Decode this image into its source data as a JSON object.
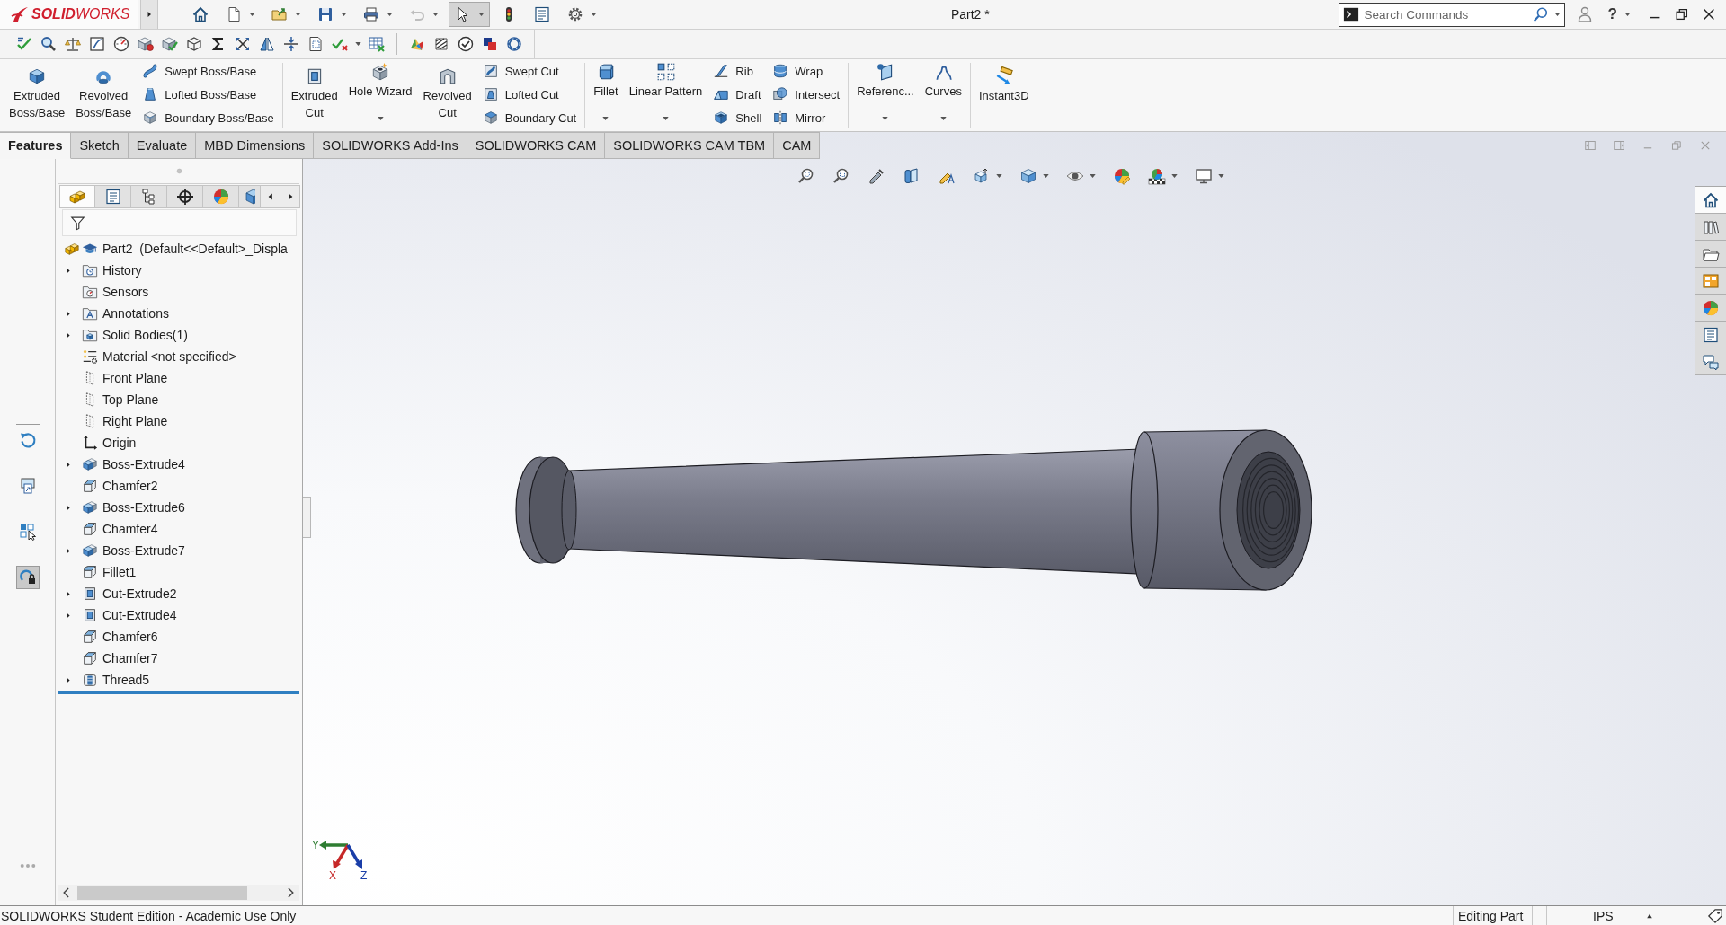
{
  "title_bar": {
    "logo": "**SOLID**WORKS",
    "quick_access": [
      {
        "kind": "home",
        "dropdown": false,
        "pressed": false,
        "disabled": false
      },
      {
        "kind": "new",
        "dropdown": true,
        "pressed": false,
        "disabled": false
      },
      {
        "kind": "open",
        "dropdown": true,
        "pressed": false,
        "disabled": false
      },
      {
        "kind": "save",
        "dropdown": true,
        "pressed": false,
        "disabled": false
      },
      {
        "kind": "print",
        "dropdown": true,
        "pressed": false,
        "disabled": false
      },
      {
        "kind": "undo",
        "dropdown": true,
        "pressed": false,
        "disabled": true
      },
      {
        "kind": "select",
        "dropdown": true,
        "pressed": true,
        "disabled": false
      },
      {
        "kind": "rebuild",
        "dropdown": false,
        "pressed": false,
        "disabled": false
      },
      {
        "kind": "file-properties",
        "dropdown": false,
        "pressed": false,
        "disabled": false
      },
      {
        "kind": "options",
        "dropdown": true,
        "pressed": false,
        "disabled": false
      }
    ],
    "document_title": "Part2 *",
    "search": {
      "placeholder": "Search Commands"
    },
    "help": "?"
  },
  "toolbar": [
    [
      {
        "kind": "tick",
        "dropdown": false
      },
      {
        "kind": "magnifier",
        "dropdown": false
      },
      {
        "kind": "balance",
        "dropdown": false
      },
      {
        "kind": "curve-box",
        "dropdown": false
      },
      {
        "kind": "gauge",
        "dropdown": false
      },
      {
        "kind": "cube-dot",
        "dropdown": false
      },
      {
        "kind": "cube-check",
        "dropdown": false
      },
      {
        "kind": "cube-outline",
        "dropdown": false
      },
      {
        "kind": "sigma",
        "dropdown": false
      },
      {
        "kind": "cross-arrows",
        "dropdown": false
      },
      {
        "kind": "mirror-halves",
        "dropdown": false
      },
      {
        "kind": "compress",
        "dropdown": false
      },
      {
        "kind": "dashed-doc",
        "dropdown": false
      },
      {
        "kind": "tick-cross",
        "dropdown": true
      },
      {
        "kind": "table-cross",
        "dropdown": false
      }
    ],
    [
      {
        "kind": "color-map",
        "dropdown": false
      },
      {
        "kind": "stripes",
        "dropdown": false
      },
      {
        "kind": "check-circle",
        "dropdown": false
      },
      {
        "kind": "squares",
        "dropdown": false
      },
      {
        "kind": "ring",
        "dropdown": false
      }
    ]
  ],
  "command_manager": {
    "groups": [
      {
        "items": [
          {
            "kind": "large",
            "label": "Extruded Boss/Base",
            "dropdown": false
          },
          {
            "kind": "large",
            "label": "Revolved Boss/Base",
            "dropdown": false
          },
          {
            "kind": "stack",
            "rows": [
              "Swept Boss/Base",
              "Lofted Boss/Base",
              "Boundary Boss/Base"
            ]
          }
        ]
      },
      {
        "items": [
          {
            "kind": "large",
            "label": "Extruded Cut",
            "dropdown": false
          },
          {
            "kind": "large",
            "label": "Hole Wizard",
            "dropdown": true
          },
          {
            "kind": "large",
            "label": "Revolved Cut",
            "dropdown": false
          },
          {
            "kind": "stack",
            "rows": [
              "Swept Cut",
              "Lofted Cut",
              "Boundary Cut"
            ]
          }
        ]
      },
      {
        "items": [
          {
            "kind": "large",
            "label": "Fillet",
            "dropdown": true
          },
          {
            "kind": "large",
            "label": "Linear Pattern",
            "dropdown": true
          },
          {
            "kind": "stack",
            "rows": [
              "Rib",
              "Draft",
              "Shell"
            ]
          },
          {
            "kind": "stack",
            "rows": [
              "Wrap",
              "Intersect",
              "Mirror"
            ]
          }
        ]
      },
      {
        "items": [
          {
            "kind": "large",
            "label": "Referenc...",
            "dropdown": true
          },
          {
            "kind": "large",
            "label": "Curves",
            "dropdown": true
          }
        ]
      },
      {
        "items": [
          {
            "kind": "large",
            "label": "Instant3D",
            "dropdown": false
          }
        ]
      }
    ]
  },
  "command_tabs": [
    {
      "label": "Features",
      "selected": true
    },
    {
      "label": "Sketch",
      "selected": false
    },
    {
      "label": "Evaluate",
      "selected": false
    },
    {
      "label": "MBD Dimensions",
      "selected": false
    },
    {
      "label": "SOLIDWORKS Add-Ins",
      "selected": false
    },
    {
      "label": "SOLIDWORKS CAM",
      "selected": false
    },
    {
      "label": "SOLIDWORKS CAM TBM",
      "selected": false
    },
    {
      "label": "CAM",
      "selected": false
    }
  ],
  "left_strip": [
    {
      "kind": "rollback",
      "pressed": false
    },
    {
      "kind": "export",
      "pressed": false
    },
    {
      "kind": "layout",
      "pressed": false
    },
    {
      "kind": "lock",
      "pressed": true
    }
  ],
  "feature_manager": {
    "panel_tabs": [
      {
        "kind": "feature-tree",
        "selected": true
      },
      {
        "kind": "property-list",
        "selected": false
      },
      {
        "kind": "configurations",
        "selected": false
      },
      {
        "kind": "dimxpert",
        "selected": false
      },
      {
        "kind": "display",
        "selected": false
      },
      {
        "kind": "cam",
        "selected": false
      }
    ],
    "tree": {
      "label": "Part2  (Default<<Default>_Displa",
      "kind": "part",
      "children": [
        {
          "label": "History",
          "kind": "history",
          "expandable": true
        },
        {
          "label": "Sensors",
          "kind": "sensors",
          "expandable": false
        },
        {
          "label": "Annotations",
          "kind": "annotations",
          "expandable": true
        },
        {
          "label": "Solid Bodies(1)",
          "kind": "solid-bodies",
          "expandable": true
        },
        {
          "label": "Material <not specified>",
          "kind": "material",
          "expandable": false
        },
        {
          "label": "Front Plane",
          "kind": "plane",
          "expandable": false
        },
        {
          "label": "Top Plane",
          "kind": "plane",
          "expandable": false
        },
        {
          "label": "Right Plane",
          "kind": "plane",
          "expandable": false
        },
        {
          "label": "Origin",
          "kind": "origin",
          "expandable": false
        },
        {
          "label": "Boss-Extrude4",
          "kind": "boss-extrude",
          "expandable": true
        },
        {
          "label": "Chamfer2",
          "kind": "chamfer",
          "expandable": false
        },
        {
          "label": "Boss-Extrude6",
          "kind": "boss-extrude",
          "expandable": true
        },
        {
          "label": "Chamfer4",
          "kind": "chamfer",
          "expandable": false
        },
        {
          "label": "Boss-Extrude7",
          "kind": "boss-extrude",
          "expandable": true
        },
        {
          "label": "Fillet1",
          "kind": "fillet",
          "expandable": false
        },
        {
          "label": "Cut-Extrude2",
          "kind": "cut-extrude",
          "expandable": true
        },
        {
          "label": "Cut-Extrude4",
          "kind": "cut-extrude",
          "expandable": true
        },
        {
          "label": "Chamfer6",
          "kind": "chamfer",
          "expandable": false
        },
        {
          "label": "Chamfer7",
          "kind": "chamfer",
          "expandable": false
        },
        {
          "label": "Thread5",
          "kind": "thread",
          "expandable": true
        }
      ]
    }
  },
  "view_toolbar": [
    {
      "kind": "zoom-fit",
      "dropdown": false
    },
    {
      "kind": "zoom-area",
      "dropdown": false
    },
    {
      "kind": "previous-view",
      "dropdown": false
    },
    {
      "kind": "section-view",
      "dropdown": false
    },
    {
      "kind": "dynamic-annotation",
      "dropdown": false
    },
    {
      "kind": "view-orientation",
      "dropdown": true
    },
    {
      "kind": "display-style",
      "dropdown": true
    },
    {
      "kind": "hide-show",
      "dropdown": true
    },
    {
      "kind": "edit-appearance",
      "dropdown": false
    },
    {
      "kind": "scene",
      "dropdown": true
    },
    {
      "kind": "view-settings",
      "dropdown": true
    }
  ],
  "triad": [
    {
      "label": "Y"
    },
    {
      "label": "X"
    },
    {
      "label": "Z"
    }
  ],
  "task_pane": [
    {
      "kind": "home",
      "selected": true
    },
    {
      "kind": "library",
      "selected": false
    },
    {
      "kind": "file-explorer",
      "selected": false
    },
    {
      "kind": "view-palette",
      "selected": false
    },
    {
      "kind": "appearances",
      "selected": false
    },
    {
      "kind": "custom-properties",
      "selected": false
    },
    {
      "kind": "forum",
      "selected": false
    }
  ],
  "status_bar": {
    "message": "SOLIDWORKS Student Edition - Academic Use Only",
    "mode": "Editing Part",
    "units": "IPS"
  }
}
